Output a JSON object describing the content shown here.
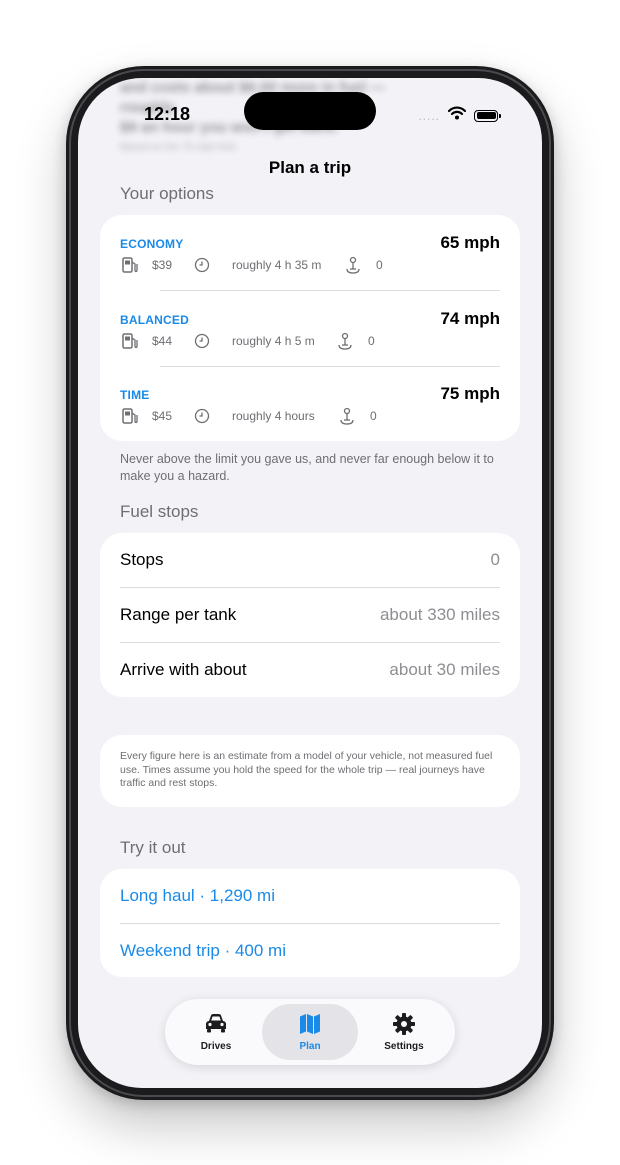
{
  "status": {
    "time": "12:18",
    "signal_dots": "....."
  },
  "background_text": {
    "line1": "and costs about $6.00 more in fuel — roughly",
    "line2": "$9 an hour you won't get back.",
    "line3": "Based on the 75 mph limit"
  },
  "nav": {
    "title": "Plan a trip"
  },
  "options": {
    "section_label": "Your options",
    "items": [
      {
        "name": "ECONOMY",
        "speed": "65 mph",
        "fuel_cost": "$39",
        "duration": "roughly 4 h 35 m",
        "stops": "0"
      },
      {
        "name": "BALANCED",
        "speed": "74 mph",
        "fuel_cost": "$44",
        "duration": "roughly 4 h 5 m",
        "stops": "0"
      },
      {
        "name": "TIME",
        "speed": "75 mph",
        "fuel_cost": "$45",
        "duration": "roughly 4 hours",
        "stops": "0"
      }
    ],
    "footnote": "Never above the limit you gave us, and never far enough below it to make you a hazard."
  },
  "fuel": {
    "section_label": "Fuel stops",
    "rows": [
      {
        "label": "Stops",
        "value": "0"
      },
      {
        "label": "Range per tank",
        "value": "about 330 miles"
      },
      {
        "label": "Arrive with about",
        "value": "about 30 miles"
      }
    ]
  },
  "disclaimer": "Every figure here is an estimate from a model of your vehicle, not measured fuel use. Times assume you hold the speed for the whole trip — real journeys have traffic and rest stops.",
  "try": {
    "section_label": "Try it out",
    "links": [
      "Long haul · 1,290 mi",
      "Weekend trip · 400 mi"
    ]
  },
  "tabs": {
    "items": [
      {
        "label": "Drives",
        "icon": "car-icon"
      },
      {
        "label": "Plan",
        "icon": "map-icon",
        "selected": true
      },
      {
        "label": "Settings",
        "icon": "gear-icon"
      }
    ]
  },
  "colors": {
    "accent": "#1a8ae8",
    "background": "#f2f2f7",
    "card": "#ffffff",
    "secondary_text": "#6e6e73"
  }
}
